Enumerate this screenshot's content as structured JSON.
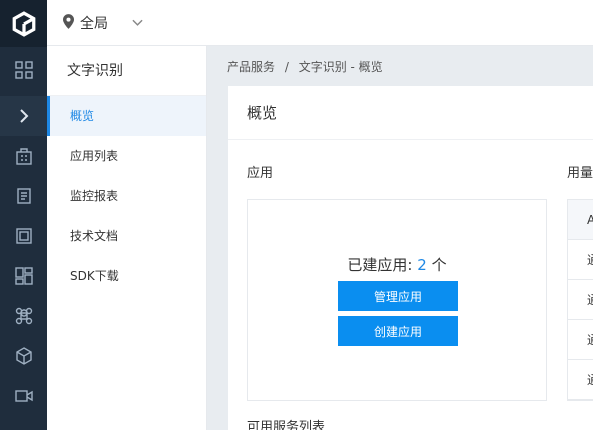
{
  "topbar": {
    "region_label": "全局"
  },
  "subnav": {
    "title": "文字识别",
    "items": [
      {
        "label": "概览",
        "active": true
      },
      {
        "label": "应用列表",
        "active": false
      },
      {
        "label": "监控报表",
        "active": false
      },
      {
        "label": "技术文档",
        "active": false
      },
      {
        "label": "SDK下载",
        "active": false
      }
    ]
  },
  "breadcrumb": {
    "parent": "产品服务",
    "separator": "/",
    "current": "文字识别 - 概览"
  },
  "panel": {
    "title": "概览",
    "apps_section_title": "应用",
    "usage_section_title": "用量",
    "app_count_prefix": "已建应用: ",
    "app_count": "2",
    "app_count_suffix": " 个",
    "manage_button": "管理应用",
    "create_button": "创建应用",
    "usage_table_header": "A",
    "usage_rows": [
      "通",
      "通",
      "通",
      "通"
    ],
    "services_section_title": "可用服务列表"
  },
  "colors": {
    "rail_bg": "#1f2d3d",
    "accent": "#1e88e5",
    "button": "#0a8ef0"
  }
}
